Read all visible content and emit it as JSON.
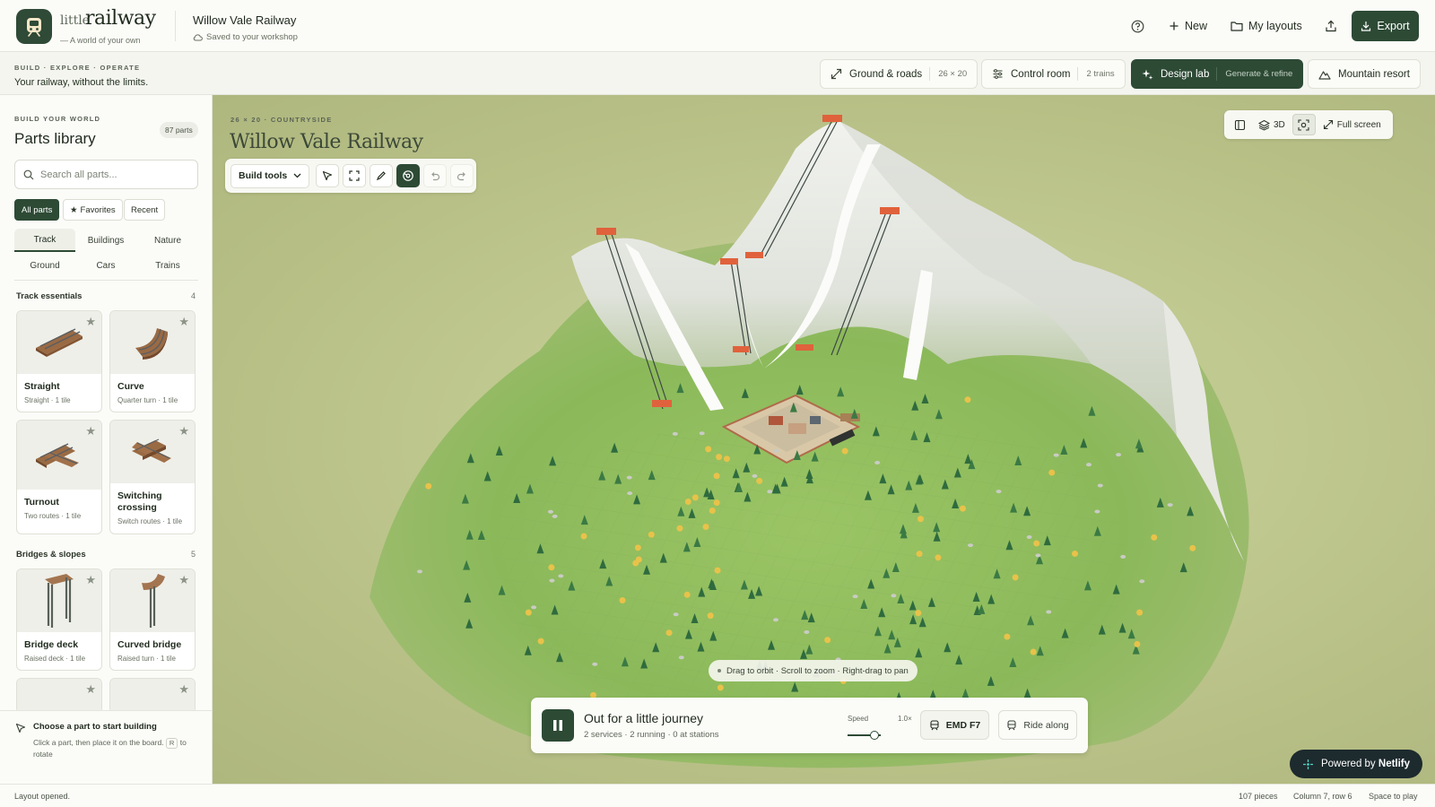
{
  "app": {
    "brand_prefix": "little",
    "brand_name": "railway",
    "tagline": "A world of your own",
    "project_title": "Willow Vale Railway",
    "save_status": "Saved to your workshop"
  },
  "header": {
    "new_label": "New",
    "my_layouts_label": "My layouts",
    "export_label": "Export"
  },
  "subbar": {
    "eyebrow": "BUILD · EXPLORE · OPERATE",
    "tagline": "Your railway, without the limits.",
    "modes": [
      {
        "label": "Ground & roads",
        "meta": "26 × 20"
      },
      {
        "label": "Control room",
        "meta": "2 trains"
      },
      {
        "label": "Design lab",
        "meta": "Generate & refine"
      },
      {
        "label": "Mountain resort"
      }
    ]
  },
  "sidebar": {
    "eyebrow": "BUILD YOUR WORLD",
    "title": "Parts library",
    "parts_count": "87 parts",
    "search_placeholder": "Search all parts...",
    "filters": [
      "All parts",
      "Favorites",
      "Recent"
    ],
    "categories": [
      "Track",
      "Buildings",
      "Nature",
      "Ground",
      "Cars",
      "Trains"
    ],
    "sections": [
      {
        "title": "Track essentials",
        "count": "4",
        "parts": [
          {
            "name": "Straight",
            "desc": "Straight · 1 tile"
          },
          {
            "name": "Curve",
            "desc": "Quarter turn · 1 tile"
          },
          {
            "name": "Turnout",
            "desc": "Two routes · 1 tile"
          },
          {
            "name": "Switching crossing",
            "desc": "Switch routes · 1 tile"
          }
        ]
      },
      {
        "title": "Bridges & slopes",
        "count": "5",
        "parts": [
          {
            "name": "Bridge deck",
            "desc": "Raised deck · 1 tile"
          },
          {
            "name": "Curved bridge",
            "desc": "Raised turn · 1 tile"
          }
        ]
      }
    ],
    "hint_title": "Choose a part to start building",
    "hint_body_1": "Click a part, then place it on the board.",
    "hint_key": "R",
    "hint_body_2": "to rotate"
  },
  "stage": {
    "eyebrow": "26 × 20 · COUNTRYSIDE",
    "title": "Willow Vale Railway",
    "build_tools_label": "Build tools",
    "view_3d_label": "3D",
    "fullscreen_label": "Full screen",
    "gesture_hint": "Drag to orbit · Scroll to zoom · Right-drag to pan"
  },
  "journey": {
    "title": "Out for a little journey",
    "stats": "2 services · 2 running · 0 at stations",
    "speed_label": "Speed",
    "speed_value": "1.0×",
    "speed_fraction": 0.8,
    "train_label": "EMD F7",
    "ride_label": "Ride along"
  },
  "netlify": {
    "prefix": "Powered by",
    "brand": "Netlify"
  },
  "status": {
    "message": "Layout opened.",
    "pieces": "107 pieces",
    "position": "Column 7, row 6",
    "shortcut": "Space to play"
  },
  "colors": {
    "accent": "#2d4a35",
    "terrain": "#8fbb5a",
    "snow": "#f2f3ef",
    "station_roof": "#e0623c",
    "autumn_tree": "#e8c24a"
  },
  "icons": {
    "logo": "train-front-icon",
    "help": "help-circle-icon",
    "new": "plus-icon",
    "layouts": "folder-icon",
    "share": "upload-icon",
    "export": "download-icon"
  }
}
